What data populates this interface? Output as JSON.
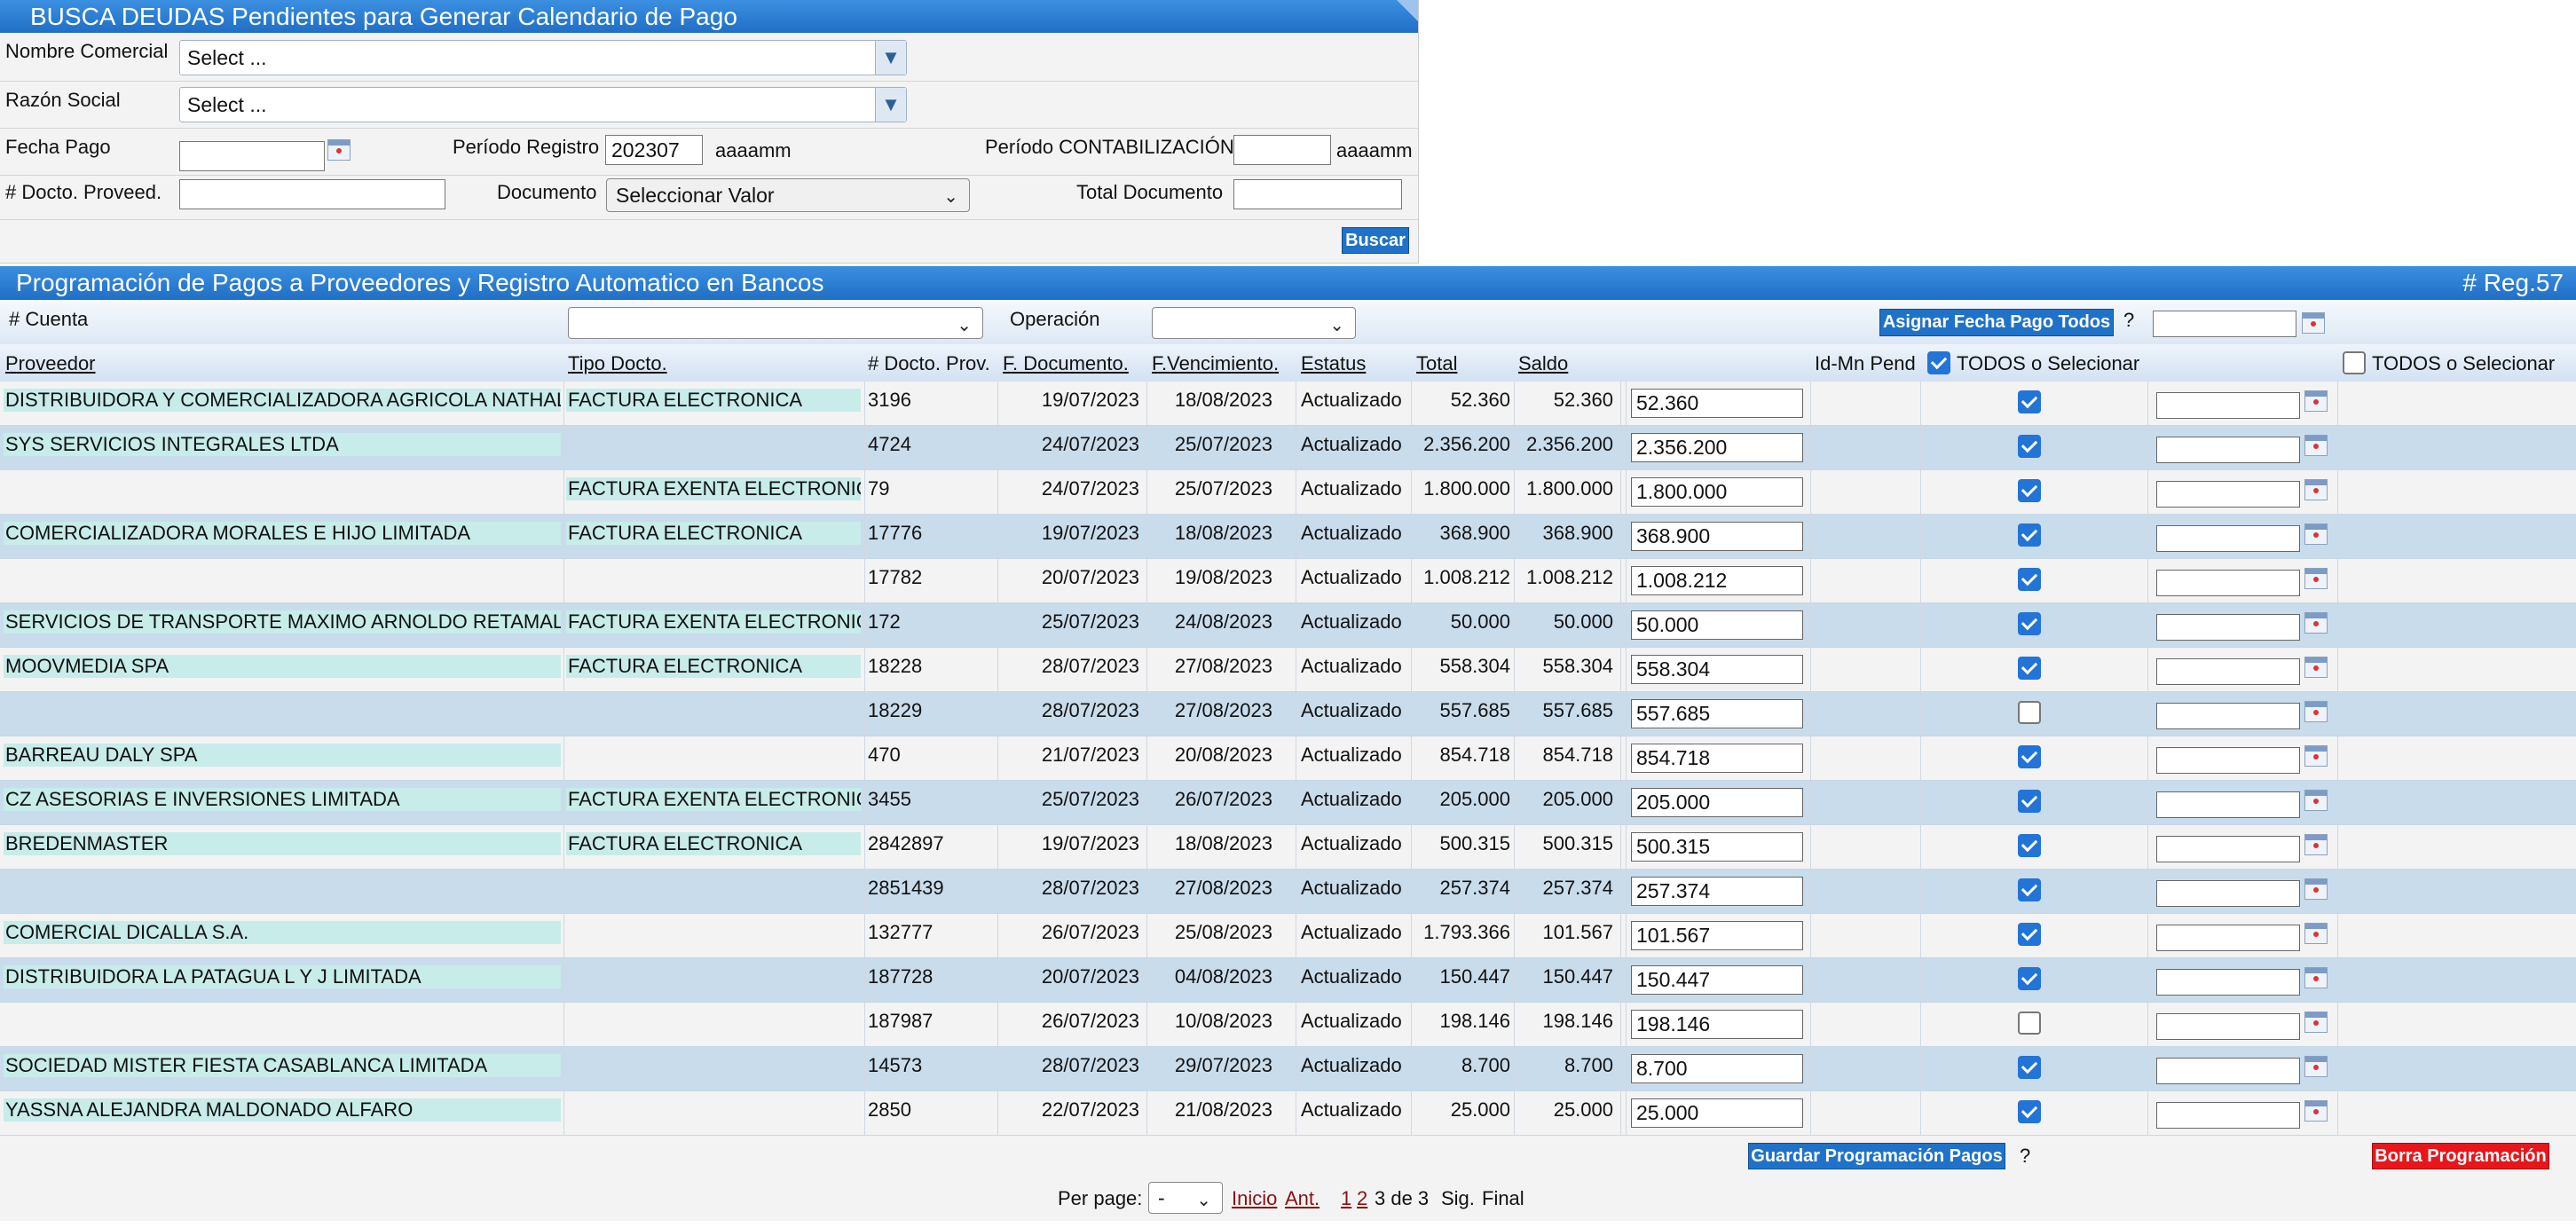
{
  "search": {
    "title": "BUSCA DEUDAS Pendientes para Generar Calendario de Pago",
    "nombre_comercial_label": "Nombre Comercial",
    "nombre_comercial_value": "Select ...",
    "razon_social_label": "Razón Social",
    "razon_social_value": "Select ...",
    "fecha_pago_label": "Fecha Pago",
    "periodo_registro_label": "Período Registro",
    "periodo_registro_value": "202307",
    "periodo_registro_hint": "aaaamm",
    "periodo_contab_label": "Período CONTABILIZACIÓN",
    "periodo_contab_hint": "aaaamm",
    "docto_proveed_label": "# Docto. Proveed.",
    "documento_label": "Documento",
    "documento_value": "Seleccionar Valor",
    "total_documento_label": "Total Documento",
    "buscar_label": "Buscar"
  },
  "grid": {
    "title": "Programación de Pagos a Proveedores y Registro Automatico en Bancos",
    "reg_count": "# Reg.57",
    "cuenta_label": "# Cuenta",
    "operacion_label": "Operación",
    "asignar_label": "Asignar Fecha Pago Todos",
    "help_mark": "?",
    "columns": {
      "proveedor": "Proveedor",
      "tipo": "Tipo Docto.",
      "docto": "# Docto. Prov.",
      "fdoc": "F. Documento.",
      "fvenc": "F.Vencimiento.",
      "estatus": "Estatus",
      "total": "Total",
      "saldo": "Saldo",
      "idmn": "Id-Mn Pend",
      "todos1": "TODOS o Selecionar",
      "todos2": "TODOS o Selecionar"
    },
    "rows": [
      {
        "proveedor": "DISTRIBUIDORA Y COMERCIALIZADORA AGRICOLA NATHALIE",
        "tipo": "FACTURA ELECTRONICA",
        "docto": "3196",
        "fdoc": "19/07/2023",
        "fvenc": "18/08/2023",
        "estatus": "Actualizado",
        "total": "52.360",
        "saldo": "52.360",
        "monto": "52.360",
        "checked": true
      },
      {
        "proveedor": "SYS SERVICIOS INTEGRALES LTDA",
        "tipo": "",
        "docto": "4724",
        "fdoc": "24/07/2023",
        "fvenc": "25/07/2023",
        "estatus": "Actualizado",
        "total": "2.356.200",
        "saldo": "2.356.200",
        "monto": "2.356.200",
        "checked": true
      },
      {
        "proveedor": "",
        "tipo": "FACTURA EXENTA ELECTRONICA",
        "docto": "79",
        "fdoc": "24/07/2023",
        "fvenc": "25/07/2023",
        "estatus": "Actualizado",
        "total": "1.800.000",
        "saldo": "1.800.000",
        "monto": "1.800.000",
        "checked": true
      },
      {
        "proveedor": "COMERCIALIZADORA MORALES E HIJO LIMITADA",
        "tipo": "FACTURA ELECTRONICA",
        "docto": "17776",
        "fdoc": "19/07/2023",
        "fvenc": "18/08/2023",
        "estatus": "Actualizado",
        "total": "368.900",
        "saldo": "368.900",
        "monto": "368.900",
        "checked": true
      },
      {
        "proveedor": "",
        "tipo": "",
        "docto": "17782",
        "fdoc": "20/07/2023",
        "fvenc": "19/08/2023",
        "estatus": "Actualizado",
        "total": "1.008.212",
        "saldo": "1.008.212",
        "monto": "1.008.212",
        "checked": true
      },
      {
        "proveedor": "SERVICIOS DE TRANSPORTE MAXIMO ARNOLDO RETAMALES",
        "tipo": "FACTURA EXENTA ELECTRONICA",
        "docto": "172",
        "fdoc": "25/07/2023",
        "fvenc": "24/08/2023",
        "estatus": "Actualizado",
        "total": "50.000",
        "saldo": "50.000",
        "monto": "50.000",
        "checked": true
      },
      {
        "proveedor": "MOOVMEDIA SPA",
        "tipo": "FACTURA ELECTRONICA",
        "docto": "18228",
        "fdoc": "28/07/2023",
        "fvenc": "27/08/2023",
        "estatus": "Actualizado",
        "total": "558.304",
        "saldo": "558.304",
        "monto": "558.304",
        "checked": true
      },
      {
        "proveedor": "",
        "tipo": "",
        "docto": "18229",
        "fdoc": "28/07/2023",
        "fvenc": "27/08/2023",
        "estatus": "Actualizado",
        "total": "557.685",
        "saldo": "557.685",
        "monto": "557.685",
        "checked": false
      },
      {
        "proveedor": "BARREAU DALY SPA",
        "tipo": "",
        "docto": "470",
        "fdoc": "21/07/2023",
        "fvenc": "20/08/2023",
        "estatus": "Actualizado",
        "total": "854.718",
        "saldo": "854.718",
        "monto": "854.718",
        "checked": true
      },
      {
        "proveedor": "CZ ASESORIAS E INVERSIONES LIMITADA",
        "tipo": "FACTURA EXENTA ELECTRONICA",
        "docto": "3455",
        "fdoc": "25/07/2023",
        "fvenc": "26/07/2023",
        "estatus": "Actualizado",
        "total": "205.000",
        "saldo": "205.000",
        "monto": "205.000",
        "checked": true
      },
      {
        "proveedor": "BREDENMASTER",
        "tipo": "FACTURA ELECTRONICA",
        "docto": "2842897",
        "fdoc": "19/07/2023",
        "fvenc": "18/08/2023",
        "estatus": "Actualizado",
        "total": "500.315",
        "saldo": "500.315",
        "monto": "500.315",
        "checked": true
      },
      {
        "proveedor": "",
        "tipo": "",
        "docto": "2851439",
        "fdoc": "28/07/2023",
        "fvenc": "27/08/2023",
        "estatus": "Actualizado",
        "total": "257.374",
        "saldo": "257.374",
        "monto": "257.374",
        "checked": true
      },
      {
        "proveedor": "COMERCIAL DICALLA S.A.",
        "tipo": "",
        "docto": "132777",
        "fdoc": "26/07/2023",
        "fvenc": "25/08/2023",
        "estatus": "Actualizado",
        "total": "1.793.366",
        "saldo": "101.567",
        "monto": "101.567",
        "checked": true
      },
      {
        "proveedor": "DISTRIBUIDORA LA PATAGUA L Y J LIMITADA",
        "tipo": "",
        "docto": "187728",
        "fdoc": "20/07/2023",
        "fvenc": "04/08/2023",
        "estatus": "Actualizado",
        "total": "150.447",
        "saldo": "150.447",
        "monto": "150.447",
        "checked": true
      },
      {
        "proveedor": "",
        "tipo": "",
        "docto": "187987",
        "fdoc": "26/07/2023",
        "fvenc": "10/08/2023",
        "estatus": "Actualizado",
        "total": "198.146",
        "saldo": "198.146",
        "monto": "198.146",
        "checked": false
      },
      {
        "proveedor": "SOCIEDAD MISTER FIESTA CASABLANCA LIMITADA",
        "tipo": "",
        "docto": "14573",
        "fdoc": "28/07/2023",
        "fvenc": "29/07/2023",
        "estatus": "Actualizado",
        "total": "8.700",
        "saldo": "8.700",
        "monto": "8.700",
        "checked": true
      },
      {
        "proveedor": "YASSNA ALEJANDRA MALDONADO ALFARO",
        "tipo": "",
        "docto": "2850",
        "fdoc": "22/07/2023",
        "fvenc": "21/08/2023",
        "estatus": "Actualizado",
        "total": "25.000",
        "saldo": "25.000",
        "monto": "25.000",
        "checked": true
      }
    ],
    "guardar_label": "Guardar Programación Pagos",
    "borrar_label": "Borra Programación"
  },
  "pager": {
    "per_page_label": "Per page:",
    "per_page_value": "-",
    "inicio": "Inicio",
    "ant": "Ant.",
    "page1": "1",
    "page2": "2",
    "current": "3 de 3",
    "sig": "Sig.",
    "final": "Final"
  },
  "icons": {
    "dropdown": "chevron-down-icon",
    "calendar": "calendar-icon",
    "checkbox": "checkbox-icon"
  }
}
